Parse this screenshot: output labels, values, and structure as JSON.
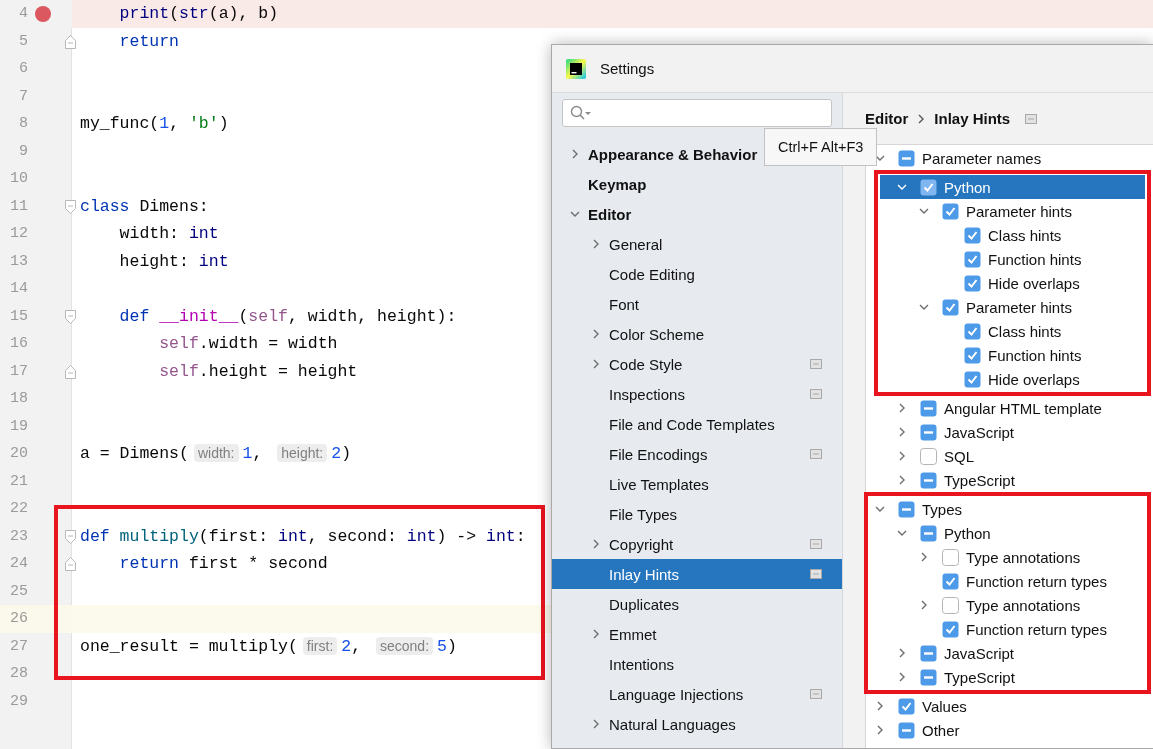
{
  "editor": {
    "lines": [
      {
        "number": "4",
        "breakpoint": true,
        "current": false,
        "fold_start": false,
        "fold_end": false,
        "framed": false,
        "tokens": [
          {
            "kind": "builtin",
            "text": "    print"
          },
          {
            "kind": "plain",
            "text": "("
          },
          {
            "kind": "builtin",
            "text": "str"
          },
          {
            "kind": "plain",
            "text": "(a), b)"
          }
        ]
      },
      {
        "number": "5",
        "breakpoint": false,
        "current": false,
        "fold_start": false,
        "fold_end": true,
        "framed": false,
        "tokens": [
          {
            "kind": "kw",
            "text": "    return"
          }
        ]
      },
      {
        "number": "6",
        "breakpoint": false,
        "current": false,
        "fold_start": false,
        "fold_end": false,
        "framed": false
      },
      {
        "number": "7",
        "breakpoint": false,
        "current": false,
        "fold_start": false,
        "fold_end": false,
        "framed": false
      },
      {
        "number": "8",
        "breakpoint": false,
        "current": false,
        "fold_start": false,
        "fold_end": false,
        "framed": false,
        "tokens": [
          {
            "kind": "plain",
            "text": "my_func("
          },
          {
            "kind": "num",
            "text": "1"
          },
          {
            "kind": "plain",
            "text": ", "
          },
          {
            "kind": "str",
            "text": "'b'"
          },
          {
            "kind": "plain",
            "text": ")"
          }
        ]
      },
      {
        "number": "9",
        "breakpoint": false,
        "current": false,
        "fold_start": false,
        "fold_end": false,
        "framed": false
      },
      {
        "number": "10",
        "breakpoint": false,
        "current": false,
        "fold_start": false,
        "fold_end": false,
        "framed": false
      },
      {
        "number": "11",
        "breakpoint": false,
        "current": false,
        "fold_start": true,
        "fold_end": false,
        "framed": false,
        "tokens": [
          {
            "kind": "kw",
            "text": "class"
          },
          {
            "kind": "plain",
            "text": " Dimens:"
          }
        ]
      },
      {
        "number": "12",
        "breakpoint": false,
        "current": false,
        "fold_start": false,
        "fold_end": false,
        "framed": false,
        "tokens": [
          {
            "kind": "plain",
            "text": "    width: "
          },
          {
            "kind": "type",
            "text": "int"
          }
        ]
      },
      {
        "number": "13",
        "breakpoint": false,
        "current": false,
        "fold_start": false,
        "fold_end": false,
        "framed": false,
        "tokens": [
          {
            "kind": "plain",
            "text": "    height: "
          },
          {
            "kind": "type",
            "text": "int"
          }
        ]
      },
      {
        "number": "14",
        "breakpoint": false,
        "current": false,
        "fold_start": false,
        "fold_end": false,
        "framed": false
      },
      {
        "number": "15",
        "breakpoint": false,
        "current": false,
        "fold_start": true,
        "fold_end": false,
        "framed": false,
        "tokens": [
          {
            "kind": "kw",
            "text": "    def "
          },
          {
            "kind": "magic",
            "text": "__init__"
          },
          {
            "kind": "plain",
            "text": "("
          },
          {
            "kind": "self",
            "text": "self"
          },
          {
            "kind": "plain",
            "text": ", width, height):"
          }
        ]
      },
      {
        "number": "16",
        "breakpoint": false,
        "current": false,
        "fold_start": false,
        "fold_end": false,
        "framed": false,
        "tokens": [
          {
            "kind": "self",
            "text": "        self"
          },
          {
            "kind": "plain",
            "text": ".width = width"
          }
        ]
      },
      {
        "number": "17",
        "breakpoint": false,
        "current": false,
        "fold_start": false,
        "fold_end": true,
        "framed": false,
        "tokens": [
          {
            "kind": "self",
            "text": "        self"
          },
          {
            "kind": "plain",
            "text": ".height = height"
          }
        ]
      },
      {
        "number": "18",
        "breakpoint": false,
        "current": false,
        "fold_start": false,
        "fold_end": false,
        "framed": false
      },
      {
        "number": "19",
        "breakpoint": false,
        "current": false,
        "fold_start": false,
        "fold_end": false,
        "framed": false
      },
      {
        "number": "20",
        "breakpoint": false,
        "current": false,
        "fold_start": false,
        "fold_end": false,
        "framed": false,
        "tokens": [
          {
            "kind": "plain",
            "text": "a = Dimens("
          },
          {
            "kind": "hint",
            "text": "width:"
          },
          {
            "kind": "num",
            "text": "1"
          },
          {
            "kind": "plain",
            "text": ", "
          },
          {
            "kind": "hint",
            "text": "height:"
          },
          {
            "kind": "num",
            "text": "2"
          },
          {
            "kind": "plain",
            "text": ")"
          }
        ]
      },
      {
        "number": "21",
        "breakpoint": false,
        "current": false,
        "fold_start": false,
        "fold_end": false,
        "framed": false
      },
      {
        "number": "22",
        "breakpoint": false,
        "current": false,
        "fold_start": false,
        "fold_end": false,
        "framed": true
      },
      {
        "number": "23",
        "breakpoint": false,
        "current": false,
        "fold_start": true,
        "fold_end": false,
        "framed": true,
        "tokens": [
          {
            "kind": "kw",
            "text": "def "
          },
          {
            "kind": "fn",
            "text": "multiply"
          },
          {
            "kind": "plain",
            "text": "(first: "
          },
          {
            "kind": "type",
            "text": "int"
          },
          {
            "kind": "plain",
            "text": ", second: "
          },
          {
            "kind": "type",
            "text": "int"
          },
          {
            "kind": "plain",
            "text": ") -> "
          },
          {
            "kind": "type",
            "text": "int"
          },
          {
            "kind": "plain",
            "text": ":"
          }
        ]
      },
      {
        "number": "24",
        "breakpoint": false,
        "current": false,
        "fold_start": false,
        "fold_end": true,
        "framed": true,
        "tokens": [
          {
            "kind": "kw",
            "text": "    return"
          },
          {
            "kind": "plain",
            "text": " first * second"
          }
        ]
      },
      {
        "number": "25",
        "breakpoint": false,
        "current": false,
        "fold_start": false,
        "fold_end": false,
        "framed": true
      },
      {
        "number": "26",
        "breakpoint": false,
        "current": true,
        "fold_start": false,
        "fold_end": false,
        "framed": true
      },
      {
        "number": "27",
        "breakpoint": false,
        "current": false,
        "fold_start": false,
        "fold_end": false,
        "framed": true,
        "tokens": [
          {
            "kind": "plain",
            "text": "one_result = multiply("
          },
          {
            "kind": "hint",
            "text": "first:"
          },
          {
            "kind": "num",
            "text": "2"
          },
          {
            "kind": "plain",
            "text": ", "
          },
          {
            "kind": "hint",
            "text": "second:"
          },
          {
            "kind": "num",
            "text": "5"
          },
          {
            "kind": "plain",
            "text": ")"
          }
        ]
      },
      {
        "number": "28",
        "breakpoint": false,
        "current": false,
        "fold_start": false,
        "fold_end": false,
        "framed": true
      },
      {
        "number": "29",
        "breakpoint": false,
        "current": false,
        "fold_start": false,
        "fold_end": false,
        "framed": false
      }
    ]
  },
  "settings": {
    "title": "Settings",
    "nav": [
      {
        "label": "Appearance & Behavior",
        "expanded": false,
        "scope_icon": false,
        "selected": false
      },
      {
        "label": "Keymap",
        "scope_icon": false,
        "selected": false
      },
      {
        "label": "Editor",
        "expanded": true,
        "scope_icon": false,
        "selected": false,
        "children": [
          {
            "label": "General",
            "expanded": false,
            "scope_icon": false,
            "selected": false
          },
          {
            "label": "Code Editing",
            "scope_icon": false,
            "selected": false
          },
          {
            "label": "Font",
            "scope_icon": false,
            "selected": false
          },
          {
            "label": "Color Scheme",
            "expanded": false,
            "scope_icon": false,
            "selected": false
          },
          {
            "label": "Code Style",
            "expanded": false,
            "scope_icon": true,
            "selected": false
          },
          {
            "label": "Inspections",
            "scope_icon": true,
            "selected": false
          },
          {
            "label": "File and Code Templates",
            "scope_icon": false,
            "selected": false
          },
          {
            "label": "File Encodings",
            "scope_icon": true,
            "selected": false
          },
          {
            "label": "Live Templates",
            "scope_icon": false,
            "selected": false
          },
          {
            "label": "File Types",
            "scope_icon": false,
            "selected": false
          },
          {
            "label": "Copyright",
            "expanded": false,
            "scope_icon": true,
            "selected": false
          },
          {
            "label": "Inlay Hints",
            "scope_icon": true,
            "selected": true
          },
          {
            "label": "Duplicates",
            "scope_icon": false,
            "selected": false
          },
          {
            "label": "Emmet",
            "expanded": false,
            "scope_icon": false,
            "selected": false
          },
          {
            "label": "Intentions",
            "scope_icon": false,
            "selected": false
          },
          {
            "label": "Language Injections",
            "scope_icon": true,
            "selected": false
          },
          {
            "label": "Natural Languages",
            "expanded": false,
            "scope_icon": false,
            "selected": false
          }
        ]
      }
    ],
    "breadcrumb": [
      "Editor",
      "Inlay Hints"
    ],
    "tree": [
      {
        "label": "Parameter names",
        "expanded": true,
        "checked": false,
        "indeterminate": true,
        "selected": false,
        "framed": false,
        "children": [
          {
            "label": "Python",
            "expanded": true,
            "checked": true,
            "indeterminate": false,
            "selected": true,
            "framed": true,
            "children": [
              {
                "label": "Parameter hints",
                "expanded": true,
                "checked": true,
                "indeterminate": false,
                "selected": false,
                "framed": false,
                "children": [
                  {
                    "label": "Class hints",
                    "checked": true,
                    "indeterminate": false,
                    "selected": false,
                    "framed": false
                  },
                  {
                    "label": "Function hints",
                    "checked": true,
                    "indeterminate": false,
                    "selected": false,
                    "framed": false
                  },
                  {
                    "label": "Hide overlaps",
                    "checked": true,
                    "indeterminate": false,
                    "selected": false,
                    "framed": false
                  }
                ]
              },
              {
                "label": "Parameter hints",
                "expanded": true,
                "checked": true,
                "indeterminate": false,
                "selected": false,
                "framed": false,
                "children": [
                  {
                    "label": "Class hints",
                    "checked": true,
                    "indeterminate": false,
                    "selected": false,
                    "framed": false
                  },
                  {
                    "label": "Function hints",
                    "checked": true,
                    "indeterminate": false,
                    "selected": false,
                    "framed": false
                  },
                  {
                    "label": "Hide overlaps",
                    "checked": true,
                    "indeterminate": false,
                    "selected": false,
                    "framed": false
                  }
                ]
              }
            ]
          },
          {
            "label": "Angular HTML template",
            "expanded": false,
            "checked": false,
            "indeterminate": true,
            "selected": false,
            "framed": false
          },
          {
            "label": "JavaScript",
            "expanded": false,
            "checked": false,
            "indeterminate": true,
            "selected": false,
            "framed": false
          },
          {
            "label": "SQL",
            "expanded": false,
            "checked": false,
            "indeterminate": false,
            "selected": false,
            "framed": false
          },
          {
            "label": "TypeScript",
            "expanded": false,
            "checked": false,
            "indeterminate": true,
            "selected": false,
            "framed": false
          }
        ]
      },
      {
        "label": "Types",
        "expanded": true,
        "checked": false,
        "indeterminate": true,
        "selected": false,
        "framed": true,
        "children": [
          {
            "label": "Python",
            "expanded": true,
            "checked": false,
            "indeterminate": true,
            "selected": false,
            "framed": false,
            "children": [
              {
                "label": "Type annotations",
                "expanded": false,
                "checked": false,
                "indeterminate": false,
                "selected": false,
                "framed": false
              },
              {
                "label": "Function return types",
                "checked": true,
                "indeterminate": false,
                "selected": false,
                "framed": false
              },
              {
                "label": "Type annotations",
                "expanded": false,
                "checked": false,
                "indeterminate": false,
                "selected": false,
                "framed": false
              },
              {
                "label": "Function return types",
                "checked": true,
                "indeterminate": false,
                "selected": false,
                "framed": false
              }
            ]
          },
          {
            "label": "JavaScript",
            "expanded": false,
            "checked": false,
            "indeterminate": true,
            "selected": false,
            "framed": false
          },
          {
            "label": "TypeScript",
            "expanded": false,
            "checked": false,
            "indeterminate": true,
            "selected": false,
            "framed": false
          }
        ]
      },
      {
        "label": "Values",
        "expanded": false,
        "checked": true,
        "indeterminate": false,
        "selected": false,
        "framed": false
      },
      {
        "label": "Other",
        "expanded": false,
        "checked": false,
        "indeterminate": true,
        "selected": false,
        "framed": false
      }
    ]
  },
  "tooltip": {
    "text": "Ctrl+F Alt+F3"
  }
}
